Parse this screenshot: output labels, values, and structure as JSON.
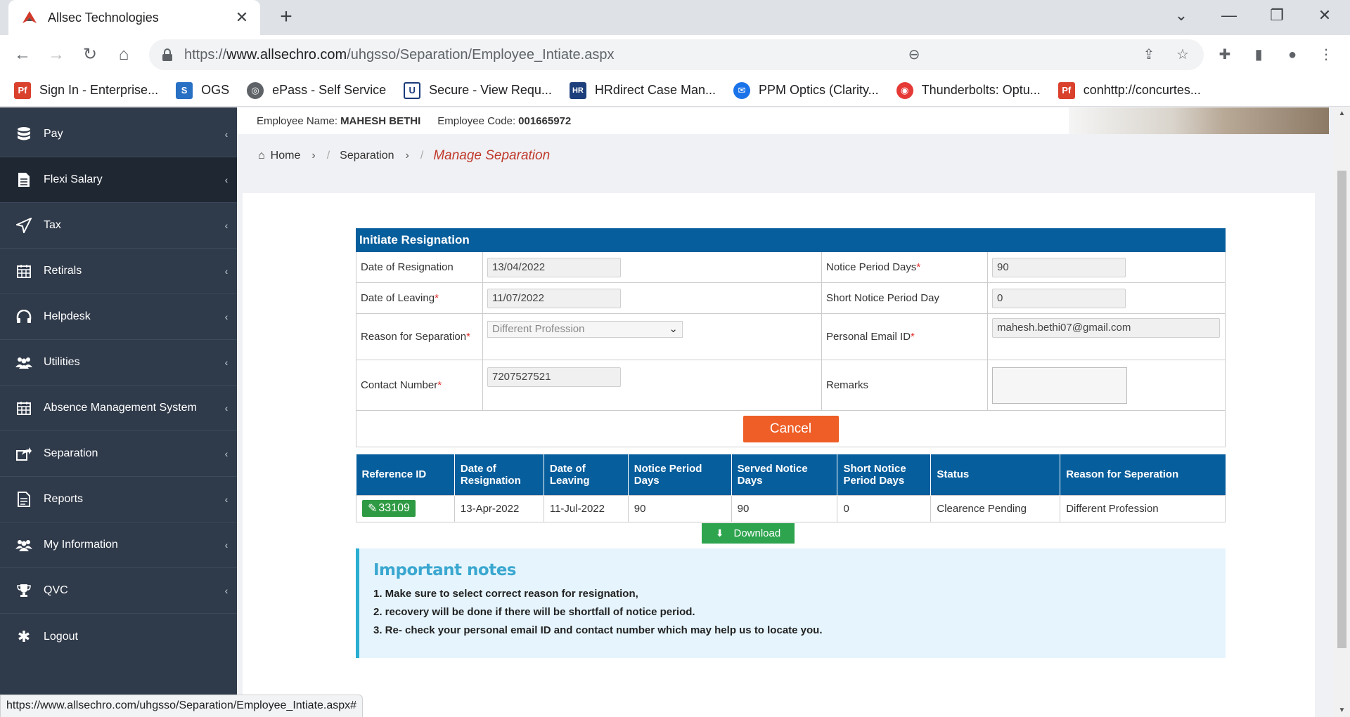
{
  "browser": {
    "tab_title": "Allsec Technologies",
    "url_prefix": "https://",
    "url_host": "www.allsechro.com",
    "url_path": "/uhgsso/Separation/Employee_Intiate.aspx",
    "status_url": "https://www.allsechro.com/uhgsso/Separation/Employee_Intiate.aspx#",
    "bookmarks": [
      {
        "label": "Sign In - Enterprise...",
        "icon": "pdf-icon"
      },
      {
        "label": "OGS",
        "icon": "sharepoint-icon"
      },
      {
        "label": "ePass - Self Service",
        "icon": "globe-icon"
      },
      {
        "label": "Secure - View Requ...",
        "icon": "u-icon"
      },
      {
        "label": "HRdirect Case Man...",
        "icon": "hr-icon"
      },
      {
        "label": "PPM Optics (Clarity...",
        "icon": "mail-icon"
      },
      {
        "label": "Thunderbolts: Optu...",
        "icon": "target-icon"
      },
      {
        "label": "conhttp://concurtes...",
        "icon": "pdf-icon"
      }
    ]
  },
  "sidebar": {
    "items": [
      {
        "label": "Pay",
        "icon": "database-icon"
      },
      {
        "label": "Flexi Salary",
        "icon": "document-icon"
      },
      {
        "label": "Tax",
        "icon": "paper-plane-icon"
      },
      {
        "label": "Retirals",
        "icon": "calendar-icon"
      },
      {
        "label": "Helpdesk",
        "icon": "headphones-icon"
      },
      {
        "label": "Utilities",
        "icon": "users-icon"
      },
      {
        "label": "Absence Management System",
        "icon": "calendar-icon"
      },
      {
        "label": "Separation",
        "icon": "share-icon"
      },
      {
        "label": "Reports",
        "icon": "file-text-icon"
      },
      {
        "label": "My Information",
        "icon": "users-icon"
      },
      {
        "label": "QVC",
        "icon": "trophy-icon"
      },
      {
        "label": "Logout",
        "icon": "gear-icon"
      }
    ]
  },
  "employee": {
    "name_label": "Employee Name:",
    "name": "MAHESH BETHI",
    "code_label": "Employee Code:",
    "code": "001665972"
  },
  "breadcrumb": {
    "home": "Home",
    "separation": "Separation",
    "current": "Manage Separation"
  },
  "form": {
    "title": "Initiate Resignation",
    "date_of_resignation_label": "Date of Resignation",
    "date_of_resignation": "13/04/2022",
    "notice_period_label": "Notice Period Days",
    "notice_period": "90",
    "date_of_leaving_label": "Date of Leaving",
    "date_of_leaving": "11/07/2022",
    "short_notice_label": "Short Notice Period Day",
    "short_notice": "0",
    "reason_label": "Reason for Separation",
    "reason": "Different Profession",
    "email_label": "Personal Email ID",
    "email": "mahesh.bethi07@gmail.com",
    "contact_label": "Contact Number",
    "contact": "7207527521",
    "remarks_label": "Remarks",
    "remarks": "",
    "required_mark": "*",
    "cancel_label": "Cancel"
  },
  "table": {
    "headers": [
      "Reference ID",
      "Date of Resignation",
      "Date of Leaving",
      "Notice Period Days",
      "Served Notice Days",
      "Short Notice Period Days",
      "Status",
      "Reason for Seperation"
    ],
    "rows": [
      [
        "33109",
        "13-Apr-2022",
        "11-Jul-2022",
        "90",
        "90",
        "0",
        "Clearence Pending",
        "Different Profession"
      ]
    ],
    "download_label": "Download"
  },
  "notes": {
    "title": "Important notes",
    "items": [
      "1. Make sure to select correct reason for resignation,",
      "2. recovery will be done if there will be shortfall of notice period.",
      "3. Re- check your personal email ID and contact number which may help us to locate you."
    ]
  }
}
